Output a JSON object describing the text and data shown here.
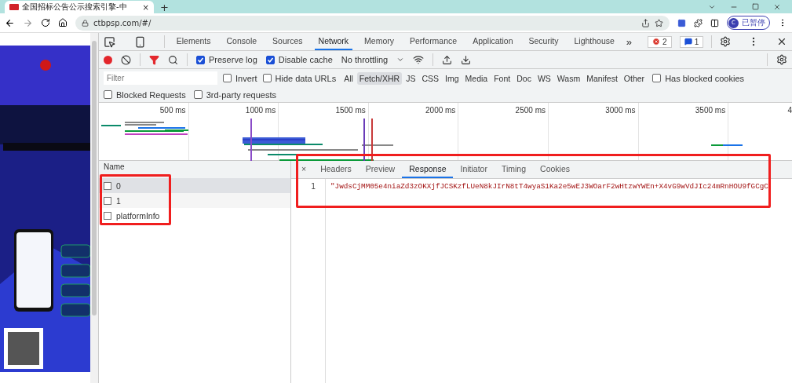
{
  "browser_tab": {
    "title": "全国招标公告公示搜索引擎-中",
    "close": "×"
  },
  "new_tab": "+",
  "address": "ctbpsp.com/#/",
  "profile": {
    "initial": "C",
    "label": "已暂停"
  },
  "devtools": {
    "panels": [
      {
        "label": "Elements",
        "selected": false
      },
      {
        "label": "Console",
        "selected": false
      },
      {
        "label": "Sources",
        "selected": false
      },
      {
        "label": "Network",
        "selected": true
      },
      {
        "label": "Memory",
        "selected": false
      },
      {
        "label": "Performance",
        "selected": false
      },
      {
        "label": "Application",
        "selected": false
      },
      {
        "label": "Security",
        "selected": false
      },
      {
        "label": "Lighthouse",
        "selected": false
      }
    ],
    "more": "»",
    "errors": "2",
    "messages": "1",
    "toolbar": {
      "recording": true,
      "preserve_log": {
        "label": "Preserve log",
        "checked": true
      },
      "disable_cache": {
        "label": "Disable cache",
        "checked": true
      },
      "throttling": "No throttling"
    },
    "filter": {
      "placeholder": "Filter",
      "invert": {
        "label": "Invert",
        "checked": false
      },
      "hide_data_urls": {
        "label": "Hide data URLs",
        "checked": false
      },
      "types": [
        {
          "label": "All",
          "selected": false
        },
        {
          "label": "Fetch/XHR",
          "selected": true
        },
        {
          "label": "JS",
          "selected": false
        },
        {
          "label": "CSS",
          "selected": false
        },
        {
          "label": "Img",
          "selected": false
        },
        {
          "label": "Media",
          "selected": false
        },
        {
          "label": "Font",
          "selected": false
        },
        {
          "label": "Doc",
          "selected": false
        },
        {
          "label": "WS",
          "selected": false
        },
        {
          "label": "Wasm",
          "selected": false
        },
        {
          "label": "Manifest",
          "selected": false
        },
        {
          "label": "Other",
          "selected": false
        }
      ],
      "has_blocked_cookies": {
        "label": "Has blocked cookies",
        "checked": false
      }
    },
    "extra_filters": [
      {
        "label": "Blocked Requests",
        "checked": false
      },
      {
        "label": "3rd-party requests",
        "checked": false
      }
    ],
    "overview": {
      "ticks": [
        "500 ms",
        "1000 ms",
        "1500 ms",
        "2000 ms",
        "2500 ms",
        "3000 ms",
        "3500 ms",
        "4"
      ]
    },
    "requests": {
      "header": "Name",
      "rows": [
        {
          "name": "0",
          "selected": true
        },
        {
          "name": "1",
          "selected": false
        },
        {
          "name": "platformInfo",
          "selected": false
        }
      ]
    },
    "details": {
      "close": "×",
      "tabs": [
        {
          "label": "Headers",
          "selected": false
        },
        {
          "label": "Preview",
          "selected": false
        },
        {
          "label": "Response",
          "selected": true
        },
        {
          "label": "Initiator",
          "selected": false
        },
        {
          "label": "Timing",
          "selected": false
        },
        {
          "label": "Cookies",
          "selected": false
        }
      ],
      "lines": [
        {
          "number": "1",
          "text": "\"JwdsCjMM05e4niaZd3zOKXjfJCSKzfLUeN8kJIrN8tT4wyaS1Ka2e5wEJ3WOarF2wHtzwYWEn+X4vG9wVdJIc24mRnHOU9fGCgC"
        }
      ]
    }
  }
}
